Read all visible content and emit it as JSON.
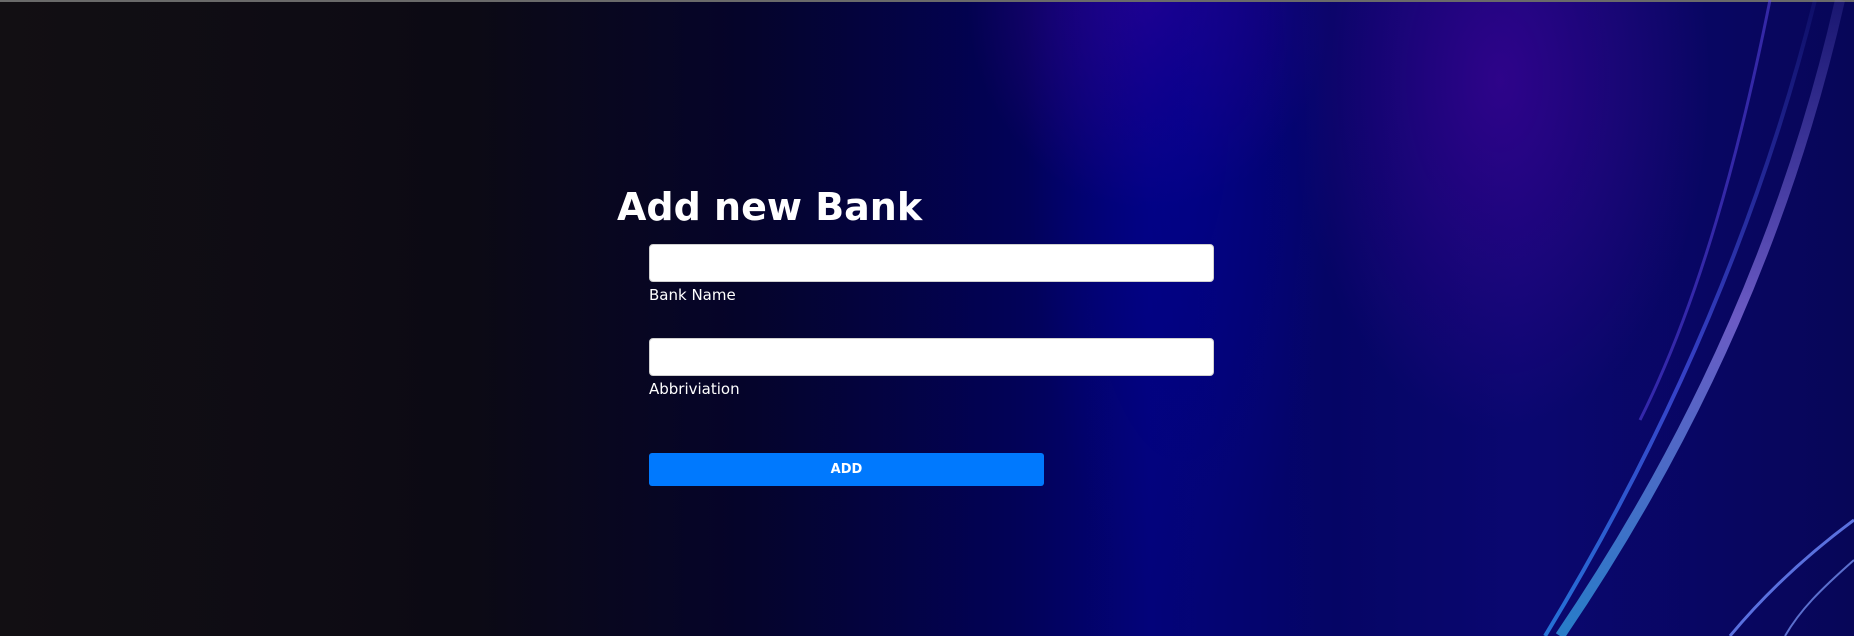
{
  "page": {
    "title": "Add new Bank"
  },
  "form": {
    "bank_name": {
      "label": "Bank Name",
      "value": "",
      "placeholder": ""
    },
    "abbreviation": {
      "label": "Abbriviation",
      "value": "",
      "placeholder": ""
    },
    "submit_label": "ADD"
  },
  "colors": {
    "button": "#0079fe",
    "text": "#ffffff",
    "input_background": "#ffffff"
  }
}
